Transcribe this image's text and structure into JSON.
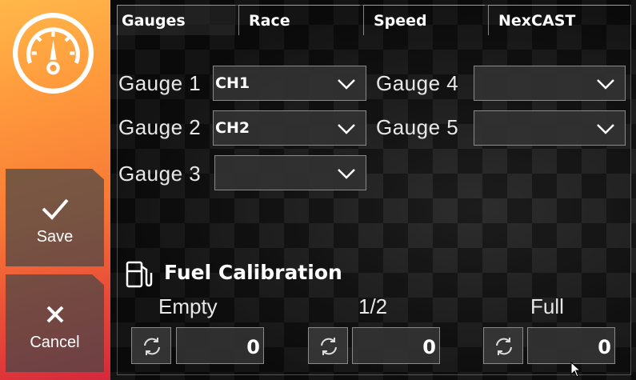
{
  "sidebar": {
    "logo_icon": "speedometer-icon",
    "save_label": "Save",
    "save_icon": "checkmark-icon",
    "cancel_label": "Cancel",
    "cancel_icon": "close-icon"
  },
  "tabs": [
    {
      "label": "Gauges",
      "active": true
    },
    {
      "label": "Race",
      "active": false
    },
    {
      "label": "Speed",
      "active": false
    },
    {
      "label": "NexCAST",
      "active": false
    }
  ],
  "gauges": [
    {
      "label": "Gauge 1",
      "value": "CH1"
    },
    {
      "label": "Gauge 2",
      "value": "CH2"
    },
    {
      "label": "Gauge 3",
      "value": ""
    },
    {
      "label": "Gauge 4",
      "value": ""
    },
    {
      "label": "Gauge 5",
      "value": ""
    }
  ],
  "fuel": {
    "title": "Fuel Calibration",
    "icon": "fuel-pump-icon",
    "points": [
      {
        "label": "Empty",
        "value": "0"
      },
      {
        "label": "1/2",
        "value": "0"
      },
      {
        "label": "Full",
        "value": "0"
      }
    ]
  },
  "colors": {
    "sidebar_top": "#ffb84a",
    "sidebar_bottom": "#d6283a"
  }
}
